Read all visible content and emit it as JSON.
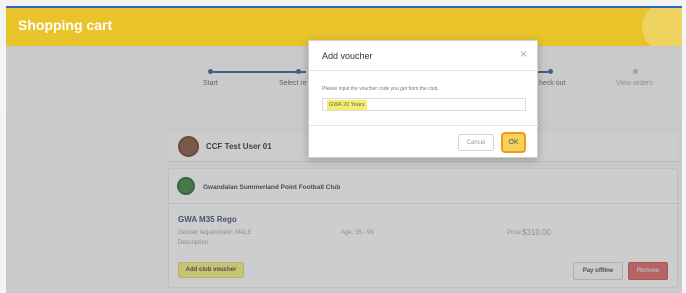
{
  "header": {
    "title": "Shopping cart"
  },
  "steps": [
    {
      "label": "Start",
      "active": true
    },
    {
      "label": "Select re",
      "active": true
    },
    {
      "label": "heck out",
      "active": true
    },
    {
      "label": "View orders",
      "active": false
    }
  ],
  "user": {
    "name": "CCF Test User 01"
  },
  "club": {
    "name": "Gwandalan Summerland Point Football Club"
  },
  "item": {
    "title": "GWA M35 Rego",
    "gender_requirement": "Gender requirement: MALE",
    "description_label": "Description",
    "age": "Age: 35 - 99",
    "price_label": "Price:",
    "price_value": "$310.00"
  },
  "buttons": {
    "add_voucher": "Add club voucher",
    "pay_offline": "Pay offline",
    "remove": "Remove"
  },
  "modal": {
    "title": "Add voucher",
    "close": "×",
    "prompt": "Please input the voucher code you get from the club.",
    "input_value": "GWA 20 Years",
    "cancel": "Cancel",
    "ok": "OK"
  },
  "colors": {
    "header_bg": "#e8c42a",
    "step_active": "#2a4e8f",
    "highlight": "#f1ec74",
    "remove_bg": "#d55a5a",
    "ok_border": "#f19a1a"
  }
}
